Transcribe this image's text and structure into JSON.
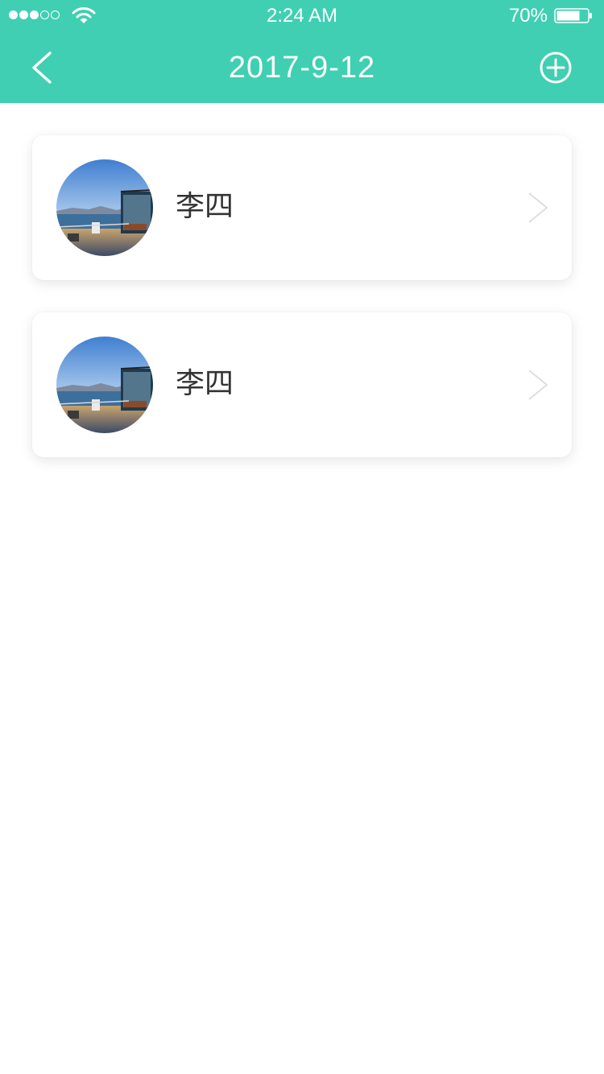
{
  "status_bar": {
    "time": "2:24 AM",
    "battery_percent": "70%",
    "signal_bars_filled": 3,
    "signal_bars_total": 5,
    "battery_level": 0.7
  },
  "nav": {
    "title": "2017-9-12",
    "back_icon": "chevron-left-icon",
    "add_icon": "plus-circle-icon"
  },
  "list": {
    "items": [
      {
        "name": "李四",
        "avatar": "terrace-sea-photo"
      },
      {
        "name": "李四",
        "avatar": "terrace-sea-photo"
      }
    ]
  },
  "colors": {
    "header_bg": "#40cfb2",
    "card_bg": "#ffffff",
    "name_text": "#333333",
    "chevron": "#d9d9d9"
  }
}
